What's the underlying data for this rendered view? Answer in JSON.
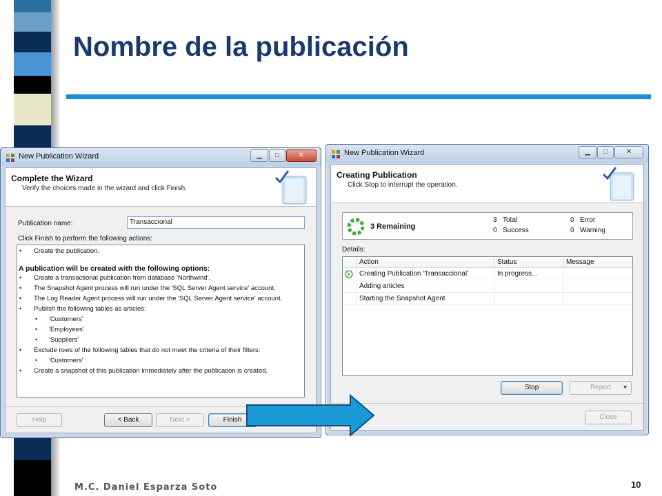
{
  "slide": {
    "title": "Nombre de la publicación",
    "author": "M.C. Daniel Esparza Soto",
    "page_number": "10",
    "accent_color": "#1b8fd2",
    "title_color": "#1a3a6e"
  },
  "left_window": {
    "title": "New Publication Wizard",
    "header_title": "Complete the Wizard",
    "header_subtitle": "Verify the choices made in the wizard and click Finish.",
    "publication_name_label": "Publication name:",
    "publication_name_value": "Transaccional",
    "instructions": "Click Finish to perform the following actions:",
    "actions": [
      "Create the publication.",
      "A publication will be created with the following options:",
      "Create a transactional publication from database 'Northwind'.",
      "The Snapshot Agent process will run under the 'SQL Server Agent service' account.",
      "The Log Reader Agent process will run under the 'SQL Server Agent service' account.",
      "Publish the following tables as articles:",
      "'Customers'",
      "'Employees'",
      "'Suppliers'",
      "Exclude rows of the following tables that do not meet the criteria of their filters:",
      "'Customers'",
      "Create a snapshot of this publication immediately after the publication is created."
    ],
    "buttons": {
      "help": "Help",
      "back": "< Back",
      "next": "Next >",
      "finish": "Finish"
    }
  },
  "right_window": {
    "title": "New Publication Wizard",
    "header_title": "Creating Publication",
    "header_subtitle": "Click Stop to interrupt the operation.",
    "remaining": "3 Remaining",
    "total_count": "3",
    "total_label": "Total",
    "success_count": "0",
    "success_label": "Success",
    "error_count": "0",
    "error_label": "Error",
    "warning_count": "0",
    "warning_label": "Warning",
    "details_label": "Details:",
    "columns": [
      "Action",
      "Status",
      "Message"
    ],
    "rows": [
      {
        "action": "Creating Publication 'Transaccional'",
        "status": "In progress...",
        "message": ""
      },
      {
        "action": "Adding articles",
        "status": "",
        "message": ""
      },
      {
        "action": "Starting the Snapshot Agent",
        "status": "",
        "message": ""
      }
    ],
    "buttons": {
      "stop": "Stop",
      "report": "Report",
      "close": "Close"
    }
  }
}
